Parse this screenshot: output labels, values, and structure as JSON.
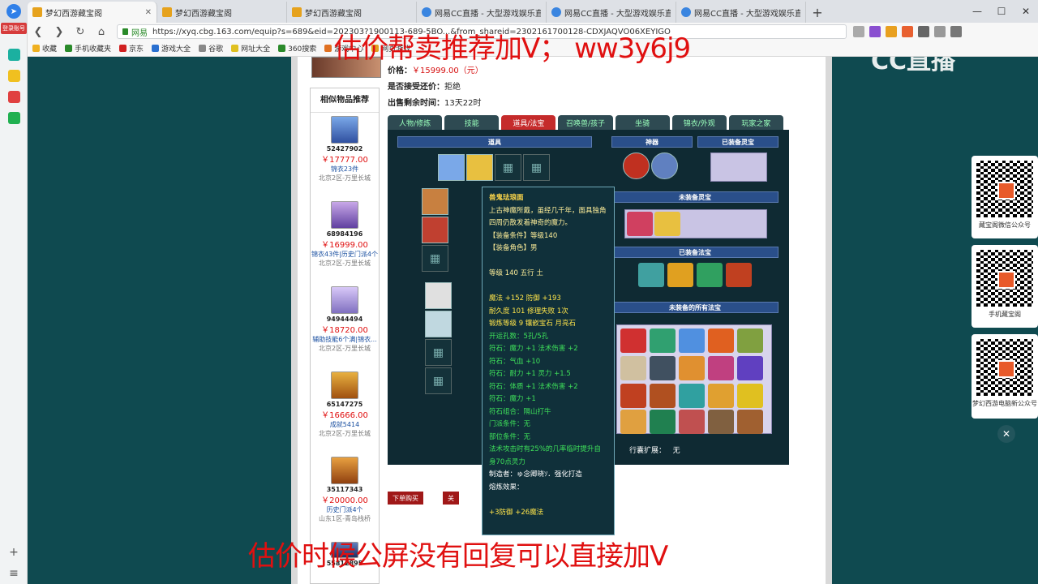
{
  "browser": {
    "tabs": [
      {
        "label": "梦幻西游藏宝阁",
        "icon": "game-icon",
        "active": true
      },
      {
        "label": "梦幻西游藏宝阁",
        "icon": "game-icon"
      },
      {
        "label": "梦幻西游藏宝阁",
        "icon": "game-icon"
      },
      {
        "label": "网易CC直播 - 大型游戏娱乐直",
        "icon": "cc-icon"
      },
      {
        "label": "网易CC直播 - 大型游戏娱乐直",
        "icon": "cc-icon"
      },
      {
        "label": "网易CC直播 - 大型游戏娱乐直",
        "icon": "cc-icon"
      }
    ],
    "new_tab": "+",
    "security_label": "网易",
    "url": "https://xyq.cbg.163.com/equip?s=689&eid=202303?1900113-689-5BO...&from_shareid=2302161700128-CDXJAQVO06XEYIGO",
    "bookmarks": [
      "收藏",
      "手机收藏夹",
      "京东",
      "游戏大全",
      "谷歌",
      "网址大全",
      "360搜索",
      "游戏中心",
      "网页游戏"
    ],
    "login_badge": "登录账号"
  },
  "overlay": {
    "top_text": "估价帮卖推荐加V； ww3y6j9",
    "bottom_text": "估价时候公屏没有回复可以直接加V",
    "cc_logo": "CC直播"
  },
  "item_info": {
    "price_label": "价格：",
    "price_value": "￥15999.00（元）",
    "bargain_label": "是否接受还价：",
    "bargain_value": "拒绝",
    "time_label": "出售剩余时间：",
    "time_value": "13天22时"
  },
  "similar": {
    "title": "相似物品推荐",
    "items": [
      {
        "id": "52427902",
        "price": "￥17777.00",
        "desc": "锦衣23件",
        "region": "北京2区-万里长城"
      },
      {
        "id": "68984196",
        "price": "￥16999.00",
        "desc": "锦衣43件|历史门派4个",
        "region": "北京2区-万里长城"
      },
      {
        "id": "94944494",
        "price": "￥18720.00",
        "desc": "辅助技能6个满|锦衣...",
        "region": "北京2区-万里长城"
      },
      {
        "id": "65147275",
        "price": "￥16666.00",
        "desc": "成就5414",
        "region": "北京2区-万里长城"
      },
      {
        "id": "35117343",
        "price": "￥20000.00",
        "desc": "历史门派4个",
        "region": "山东1区-青岛栈桥"
      },
      {
        "id": "55812895",
        "price": "",
        "desc": "",
        "region": ""
      }
    ]
  },
  "game_tabs": [
    "人物/修炼",
    "技能",
    "道具/法宝",
    "召唤兽/孩子",
    "坐骑",
    "锦衣/外观",
    "玩家之家"
  ],
  "sections": {
    "props": "道具",
    "artifact": "神器",
    "equipped_spirit": "已装备灵宝",
    "unequipped_spirit": "未装备灵宝",
    "equipped_treasure": "已装备法宝",
    "all_treasure": "未装备的所有法宝",
    "bag_label": "行囊扩展：",
    "bag_value": "无"
  },
  "tooltip": {
    "name": "兽鬼珐琅面",
    "desc": "上古神魔所戴，虽经几千年，面具独角四周仍散发着神奇的魔力。",
    "req_level": "【装备条件】等级140",
    "req_gender": "【装备角色】男",
    "level_line": "等级 140  五行 土",
    "stat1": "魔法 +152 防御 +193",
    "stat2": "耐久度 101  修理失败 1次",
    "stat3": "锻炼等级 9  镶嵌宝石 月亮石",
    "slots": "开运孔数：5孔/5孔",
    "rune1": "符石：魔力 +1 法术伤害 +2",
    "rune2": "符石：气血 +10",
    "rune3": "符石：耐力 +1 灵力 +1.5",
    "rune4": "符石：体质 +1 法术伤害 +2",
    "rune5": "符石：魔力 +1",
    "combo": "符石组合：隔山打牛",
    "school": "门派条件：无",
    "part": "部位条件：无",
    "effect": "法术攻击时有25%的几率临时提升自身70点灵力",
    "maker": "制造者：ゅ念卿晓ｿ．强化打造",
    "refine": "熔炼效果：",
    "refine_value": "+3防御 +26魔法"
  },
  "buttons": {
    "buy": "下单购买",
    "follow": "关"
  },
  "qr": [
    {
      "label": "藏宝阁微信公众号"
    },
    {
      "label": "手机藏宝阁"
    },
    {
      "label": "梦幻西游电脑新公众号"
    }
  ],
  "colors": {
    "accent_red": "#e01010",
    "page_bg": "#0f4a50",
    "panel_bg": "#0f2a33",
    "active_tab": "#c52b2b"
  }
}
